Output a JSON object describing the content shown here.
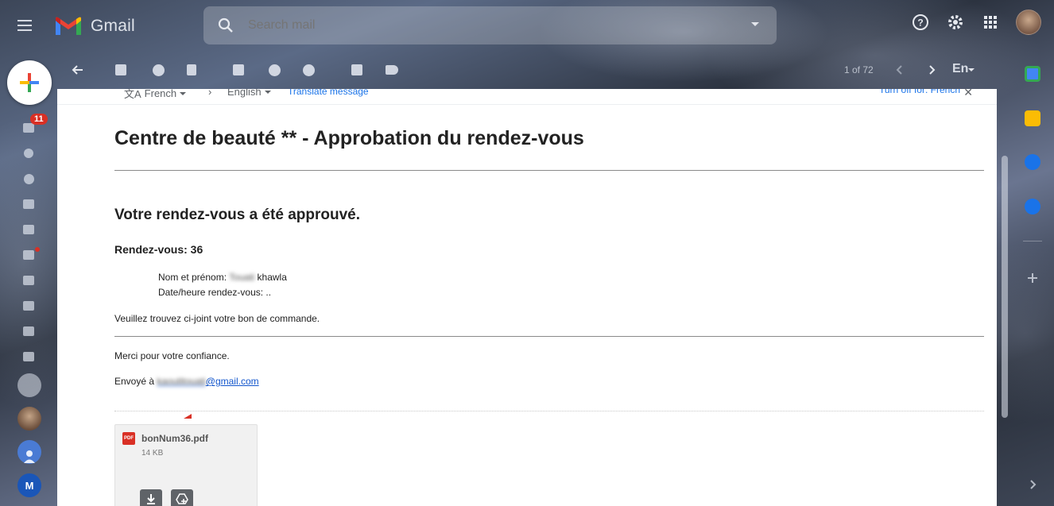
{
  "app": {
    "title": "Gmail"
  },
  "search": {
    "placeholder": "Search mail"
  },
  "left_rail": {
    "inbox_badge": "11",
    "account_initial": "M"
  },
  "toolbar": {
    "pager": "1 of 72",
    "language": "En"
  },
  "translate_bar": {
    "from_language": "French",
    "to_language": "English",
    "translate_link": "Translate message",
    "turn_off": "Turn off for: French",
    "close": "✕"
  },
  "email": {
    "subject": "Centre de beauté ** - Approbation du rendez-vous",
    "heading": "Votre rendez-vous a été approuvé.",
    "appointment_label": "Rendez-vous: 36",
    "name_label": "Nom et prénom:",
    "name_blurred": "Touati",
    "name_value": "khawla",
    "datetime_label": "Date/heure rendez-vous: ..",
    "note": "Veuillez trouvez ci-joint votre bon de commande.",
    "thanks": "Merci pour votre confiance.",
    "sent_to_label": "Envoyé à",
    "sent_to_blurred": "kaoutitouati",
    "sent_to_domain": "@gmail.com"
  },
  "attachment": {
    "icon_label": "PDF",
    "filename": "bonNum36.pdf",
    "size": "14 KB"
  },
  "colors": {
    "gmail_red": "#d93025",
    "link_blue": "#1155cc",
    "google_blue": "#1a73e8"
  }
}
